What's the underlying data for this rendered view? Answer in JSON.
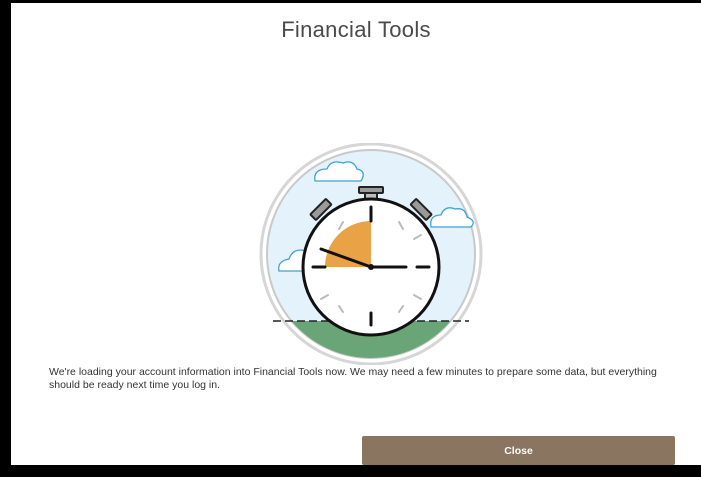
{
  "dialog": {
    "title": "Financial Tools",
    "message": "We're loading your account information into Financial Tools now. We may need a few minutes to prepare some data, but everything should be ready next time you log in.",
    "close_label": "Close"
  },
  "illustration": {
    "icon": "stopwatch-icon",
    "colors": {
      "sky": "#e3f2fb",
      "ground": "#6aa577",
      "elapsed": "#e9a246",
      "cloud": "#3ea1d6"
    }
  }
}
